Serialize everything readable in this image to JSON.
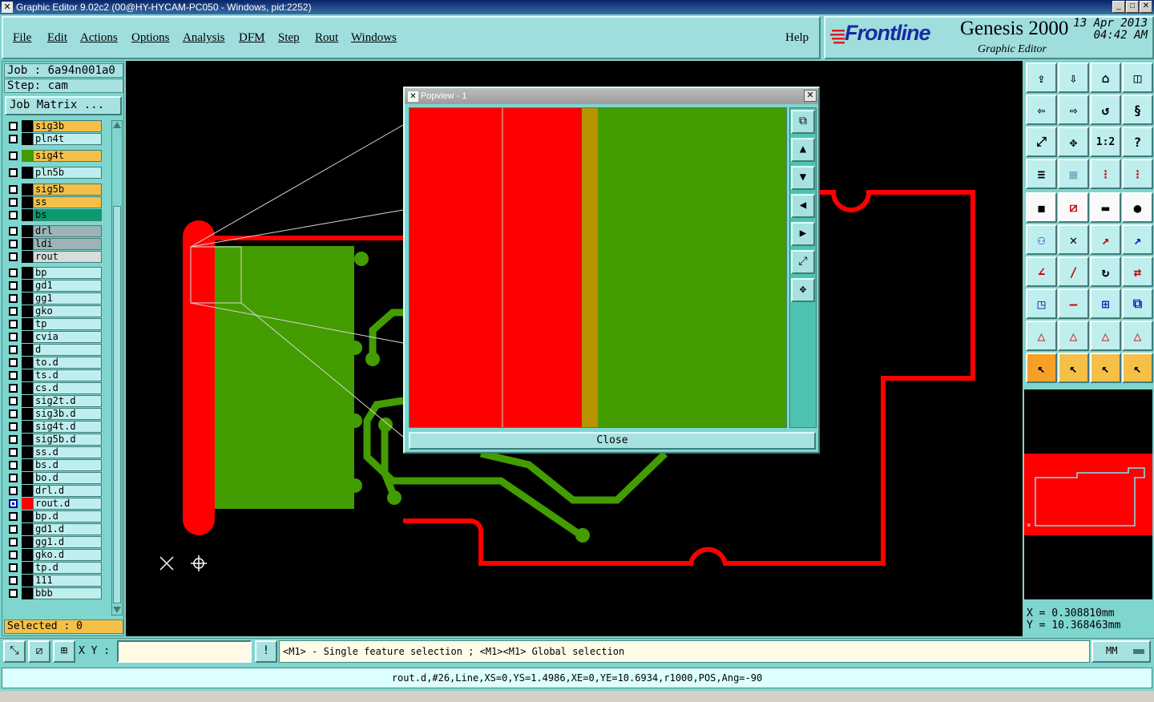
{
  "window": {
    "title": "Graphic Editor 9.02c2 (00@HY-HYCAM-PC050 - Windows, pid:2252)",
    "minimize": "_",
    "maximize": "□",
    "close": "✕"
  },
  "menu": {
    "items": [
      "File",
      "Edit",
      "Actions",
      "Options",
      "Analysis",
      "DFM",
      "Step",
      "Rout",
      "Windows"
    ],
    "help": "Help"
  },
  "brand": {
    "logo": "Frontline",
    "product": "Genesis 2000",
    "subtitle": "Graphic Editor",
    "date": "13 Apr 2013",
    "time": "04:42 AM"
  },
  "job": {
    "job_line": "Job : 6a94n001a0",
    "step_line": "Step: cam",
    "matrix_button": "Job Matrix ..."
  },
  "layers": [
    {
      "name": "sig3b",
      "label_color": "#f5c048",
      "swatch": "#000000"
    },
    {
      "name": "pln4t",
      "label_color": "#bfeeee",
      "swatch": "#000000"
    },
    {
      "name": "sig4t",
      "label_color": "#f5c048",
      "swatch": "#439c00"
    },
    {
      "name": "pln5b",
      "label_color": "#bfeeee",
      "swatch": "#000000"
    },
    {
      "name": "sig5b",
      "label_color": "#f5c048",
      "swatch": "#000000"
    },
    {
      "name": "ss",
      "label_color": "#f5c048",
      "swatch": "#000000"
    },
    {
      "name": "bs",
      "label_color": "#0b9b6e",
      "swatch": "#000000"
    },
    {
      "name": "drl",
      "label_color": "#9ab4b8",
      "swatch": "#000000"
    },
    {
      "name": "ldi",
      "label_color": "#9ab4b8",
      "swatch": "#000000"
    },
    {
      "name": "rout",
      "label_color": "#d8dcdc",
      "swatch": "#000000"
    },
    {
      "name": "bp",
      "label_color": "#bfeeee",
      "swatch": "#000000"
    },
    {
      "name": "gd1",
      "label_color": "#bfeeee",
      "swatch": "#000000"
    },
    {
      "name": "gg1",
      "label_color": "#bfeeee",
      "swatch": "#000000"
    },
    {
      "name": "gko",
      "label_color": "#bfeeee",
      "swatch": "#000000"
    },
    {
      "name": "tp",
      "label_color": "#bfeeee",
      "swatch": "#000000"
    },
    {
      "name": "cvia",
      "label_color": "#bfeeee",
      "swatch": "#000000"
    },
    {
      "name": "d",
      "label_color": "#bfeeee",
      "swatch": "#000000"
    },
    {
      "name": "to.d",
      "label_color": "#bfeeee",
      "swatch": "#000000"
    },
    {
      "name": "ts.d",
      "label_color": "#bfeeee",
      "swatch": "#000000"
    },
    {
      "name": "cs.d",
      "label_color": "#bfeeee",
      "swatch": "#000000"
    },
    {
      "name": "sig2t.d",
      "label_color": "#bfeeee",
      "swatch": "#000000"
    },
    {
      "name": "sig3b.d",
      "label_color": "#bfeeee",
      "swatch": "#000000"
    },
    {
      "name": "sig4t.d",
      "label_color": "#bfeeee",
      "swatch": "#000000"
    },
    {
      "name": "sig5b.d",
      "label_color": "#bfeeee",
      "swatch": "#000000"
    },
    {
      "name": "ss.d",
      "label_color": "#bfeeee",
      "swatch": "#000000"
    },
    {
      "name": "bs.d",
      "label_color": "#bfeeee",
      "swatch": "#000000"
    },
    {
      "name": "bo.d",
      "label_color": "#bfeeee",
      "swatch": "#000000"
    },
    {
      "name": "drl.d",
      "label_color": "#bfeeee",
      "swatch": "#000000"
    },
    {
      "name": "rout.d",
      "label_color": "#bfeeee",
      "swatch": "#ff0000",
      "active": true
    },
    {
      "name": "bp.d",
      "label_color": "#bfeeee",
      "swatch": "#000000"
    },
    {
      "name": "gd1.d",
      "label_color": "#bfeeee",
      "swatch": "#000000"
    },
    {
      "name": "gg1.d",
      "label_color": "#bfeeee",
      "swatch": "#000000"
    },
    {
      "name": "gko.d",
      "label_color": "#bfeeee",
      "swatch": "#000000"
    },
    {
      "name": "tp.d",
      "label_color": "#bfeeee",
      "swatch": "#000000"
    },
    {
      "name": "111",
      "label_color": "#bfeeee",
      "swatch": "#000000"
    },
    {
      "name": "bbb",
      "label_color": "#bfeeee",
      "swatch": "#000000"
    }
  ],
  "selected": "Selected : 0",
  "popview": {
    "title": "Popview - 1",
    "close_button": "Close"
  },
  "coords": {
    "x": "X = 0.308810mm",
    "y": "Y = 10.368463mm"
  },
  "bottom": {
    "xy_label": "X Y :",
    "xy_value": "",
    "prompt": "<M1> - Single feature selection ; <M1><M1> Global selection",
    "units": "MM",
    "status": "rout.d,#26,Line,XS=0,YS=1.4986,XE=0,YE=10.6934,r1000,POS,Ang=-90"
  },
  "colors": {
    "rout": "#ff0000",
    "signal": "#439c00",
    "overlap": "#b89400",
    "panel": "#7fd6ce"
  }
}
